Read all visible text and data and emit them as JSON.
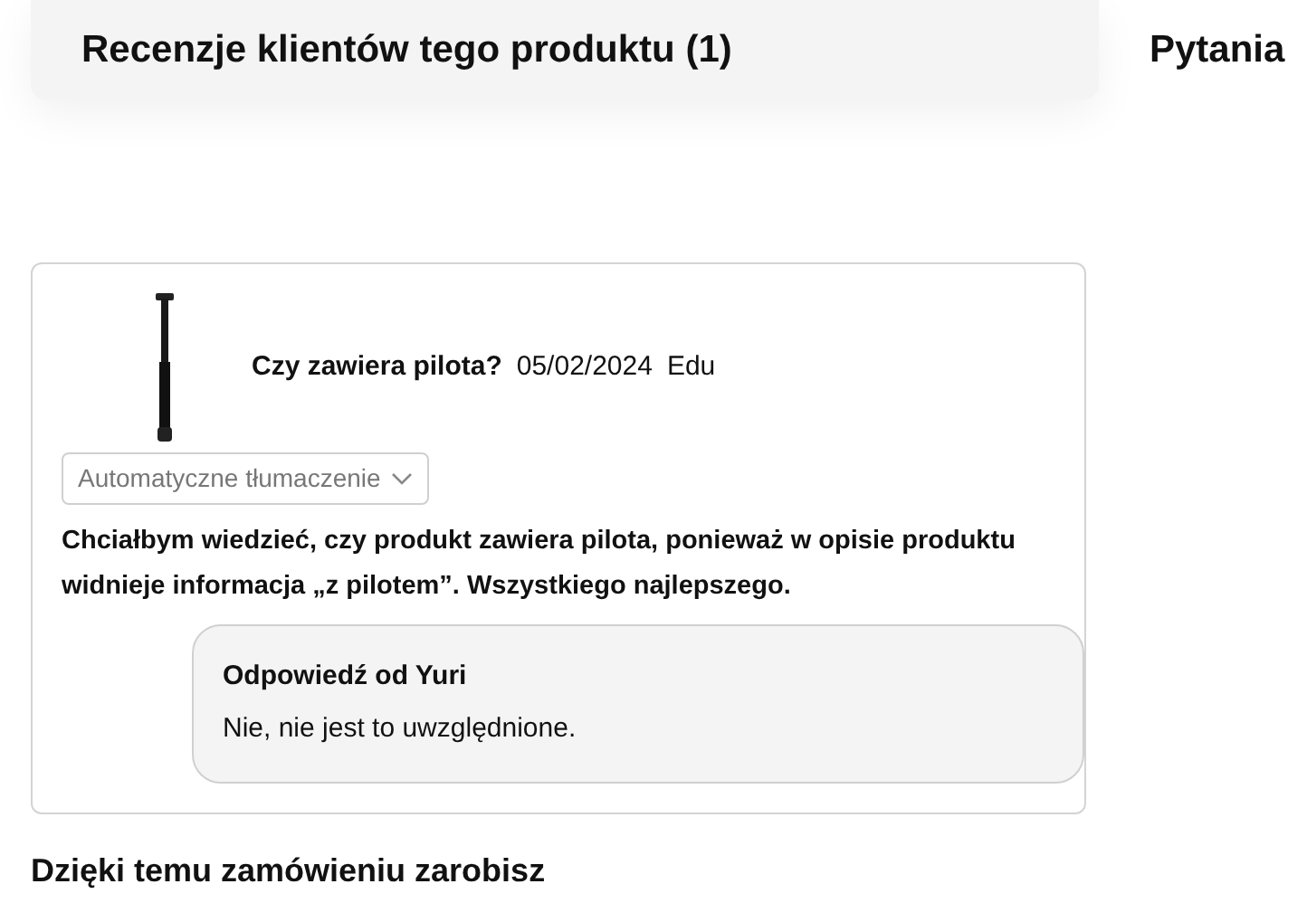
{
  "tabs": [
    {
      "label": "Recenzje klientów tego produktu (1)",
      "selected": true
    },
    {
      "label": "Pytania",
      "selected": false
    }
  ],
  "question": {
    "title": "Czy zawiera pilota?",
    "date": "05/02/2024",
    "author": "Edu",
    "translation_dropdown": "Automatyczne tłumaczenie",
    "text": "Chciałbym wiedzieć, czy produkt zawiera pilota, ponieważ w opisie produktu widnieje informacja „z pilotem”. Wszystkiego najlepszego.",
    "answer": {
      "title": "Odpowiedź od Yuri",
      "text": "Nie, nie jest to uwzględnione."
    }
  },
  "earnings_heading": "Dzięki temu zamówieniu zarobisz"
}
